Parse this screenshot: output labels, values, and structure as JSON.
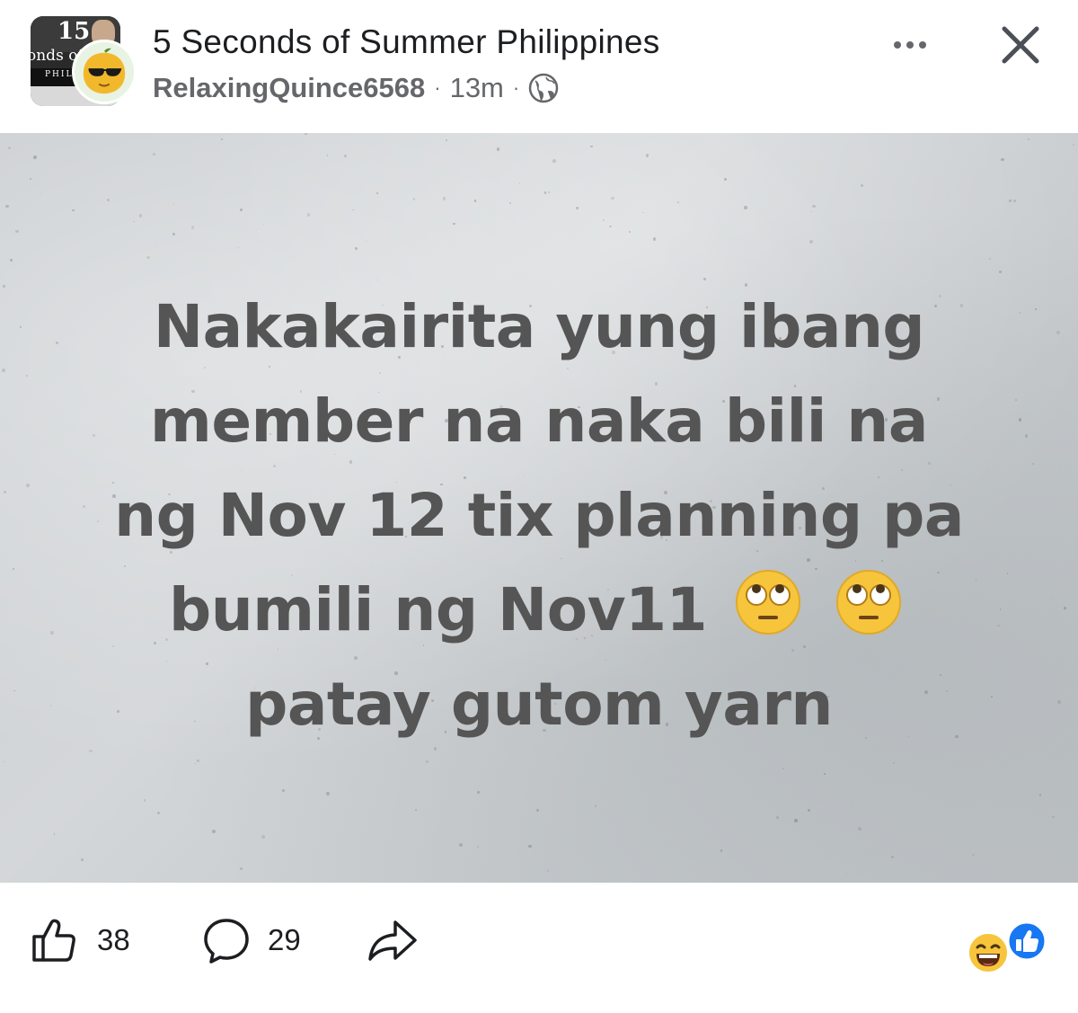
{
  "header": {
    "group_name": "5 Seconds of Summer Philippines",
    "author": "RelaxingQuince6568",
    "separator": "·",
    "time": "13m",
    "privacy_icon": "globe-icon",
    "more_icon": "more-dots-icon",
    "close_icon": "close-icon",
    "group_avatar_text": "onds of",
    "group_avatar_subtext": "PHILIP"
  },
  "post": {
    "lines": [
      "Nakakairita yung ibang",
      "member na naka bili na",
      "ng Nov 12 tix planning pa",
      "bumili ng Nov11",
      "patay gutom yarn"
    ],
    "emoji": "face-with-rolling-eyes",
    "text_color": "#555555"
  },
  "footer": {
    "like_count": "38",
    "comment_count": "29",
    "like_icon": "thumbs-up-icon",
    "comment_icon": "comment-bubble-icon",
    "share_icon": "share-arrow-icon",
    "reactions": [
      "laughing-emoji",
      "like-reaction"
    ],
    "accent_color": "#1877f2"
  }
}
